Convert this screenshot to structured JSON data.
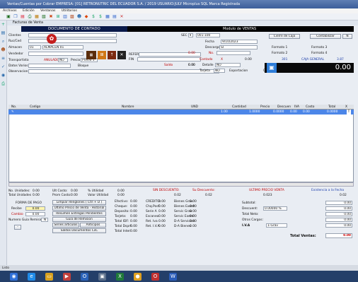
{
  "window": {
    "title": "Ventas/Cuentas por Cobrar    EMPRESA: [01] RETRONUTRIC DEL ECUADOR S.A. / 2019      USUARIO:JULY  Microplus SQL Marca Registrada"
  },
  "menu": [
    "Archivos",
    "Edición",
    "Ventanas",
    "Utilitarios"
  ],
  "form": {
    "title": "Facturas de Venta",
    "doc_header": "DOCUMENTO DE CONTADO",
    "module": "Modulo de VENTAS"
  },
  "fields": {
    "clientes": "Clientes",
    "rucced": "Ruc/Ced",
    "almacen": "Almacen",
    "almacen_code": "01",
    "almacen_name": "ALMACEN 01",
    "vendedor": "Vendedor",
    "transportista": "Transportista",
    "datos_varios": "Datos Varios",
    "observacion": "Observacion",
    "anulado": "ANULADO",
    "anulado_val": "NO",
    "precio": "Precio",
    "precio_val": "Precio 1",
    "bloque": "Bloque",
    "referen": "REFEREN",
    "fin": "FIN",
    "sec": "SEC",
    "sec_code": "001-100",
    "fecha": "Fecha",
    "fecha_val": "9/10/2023",
    "descargo": "Descargo",
    "descargo_val": "SI",
    "no": "No.",
    "no_val": "0.00",
    "no_val2": "0.00",
    "contado": "Contado",
    "contado_val1": "0.00",
    "x": "X",
    "contado_val2": "0.00",
    "detalle": "Detalle",
    "detalle_val": "NO",
    "saldo": "Saldo",
    "saldo_val": "0.00",
    "tarjeta": "Tarjeta",
    "tarjeta_val": "NO",
    "exportacion": "Exportacion",
    "exp_val": "0.00",
    "cierre_caja": "Cierre de Caja",
    "contabilizar": "Contabilizar",
    "n_btn": "N",
    "formato1": "Formato 1",
    "formato2": "Formato 2",
    "formato3": "Formato 3",
    "formato4": "Formato 4",
    "code301": "301",
    "caja_general": "CAJA GENERAL",
    "caja_val": "3.87",
    "total_big": "0.00"
  },
  "grid": {
    "headers": [
      "No.",
      "Codigo",
      "Nombre",
      "UND",
      "Cantidad",
      "Precio",
      "Descuen",
      "IVA",
      "Costo",
      "Total",
      "X"
    ],
    "row": [
      "",
      "",
      "",
      "",
      "1.00",
      "1.0000",
      "0.0000",
      "0.00",
      "0.00",
      "0.0000"
    ]
  },
  "totals_left": {
    "no_unidades": "No. Unidades:",
    "no_unidades_val": "0.00",
    "total_unidades": "Total Unidades",
    "total_unidades_val": "0.00",
    "ult_costo": "Ult Costo:",
    "ult_costo_val": "0.00",
    "prom_costo": "Prom Costo:",
    "prom_costo_val": "0.00",
    "pct_utilidad": "% Utilidad",
    "pct_utilidad_val": "0.00",
    "valor_utilidad": "Valor Utilidad",
    "valor_utilidad_val": "0.00",
    "forma_pago": "FORMA DE PAGO",
    "recibe": "Recibe",
    "recibe_val": "0.00",
    "cambio": "Cambio",
    "cambio_val": "0.00",
    "numero_guia": "Numero Guia Remision",
    "numero_guia_val": "N",
    "minus": "-"
  },
  "buttons": {
    "clear": "Limpiar Renglones ( Ctrl + D )",
    "ultimo_precio": "Ultimo Precio de Venta - Historial",
    "resumen": "Resumen Entregas Pendientes",
    "guia": "Guia de Remision",
    "series": "Series articulos",
    "anticipos": "Anticipos",
    "saldos": "Saldos Documentos CxC"
  },
  "payments": [
    [
      "Efectivo:",
      "0.00",
      "CREDITO:",
      "0.00",
      "Bienes Grav",
      "0.00"
    ],
    [
      "Cheque:",
      "0.00",
      "Chq.Posf",
      "0.00",
      "Bienes Exent",
      "0.00"
    ],
    [
      "Deposito:",
      "0.00",
      "Serie A",
      "0.00",
      "Servic Grav",
      "0.00"
    ],
    [
      "Tarjeta:",
      "0.00",
      "Escaneo",
      "0.00",
      "Servic Exent",
      "0.00"
    ],
    [
      "Total IDF:",
      "0.00",
      "Ret. Iva",
      "0.00",
      "D-A Servicios",
      "0.00"
    ],
    [
      "Total Dsprt:",
      "0.00",
      "Ret. I.V.A",
      "0.00",
      "D-A Bienes",
      "0.00"
    ],
    [
      "Total Inter:",
      "0.00",
      "",
      "",
      "",
      ""
    ]
  ],
  "discount": {
    "sin_descuento": "SIN DESCUENTO:",
    "sin_val": "0.02",
    "su_descuento": "Su Descuento:",
    "su_val": "0.02",
    "ultimo_precio": "ULTIMO PRECIO VENTA",
    "ultimo_val": "0.023",
    "existencia": "Existencia a la Fecha",
    "existencia_val": "0.02"
  },
  "summary": {
    "subtotal": "Subtotal:",
    "subtotal_val": "0.00",
    "descuent": "Descuent:",
    "descuent_pct": "0.00000 %",
    "descuent_val": "0.00",
    "total_neto": "Total Neto:",
    "total_neto_val": "0.00",
    "otros_cargos": "Otros Cargos:",
    "otros_val": "0.00",
    "iva": "I.V.A",
    "iva_sel": "1-Grav",
    "iva_val": "0.00",
    "total_ventas": "Total Ventas:",
    "total_ventas_val": "0.00"
  },
  "status": "Listo"
}
